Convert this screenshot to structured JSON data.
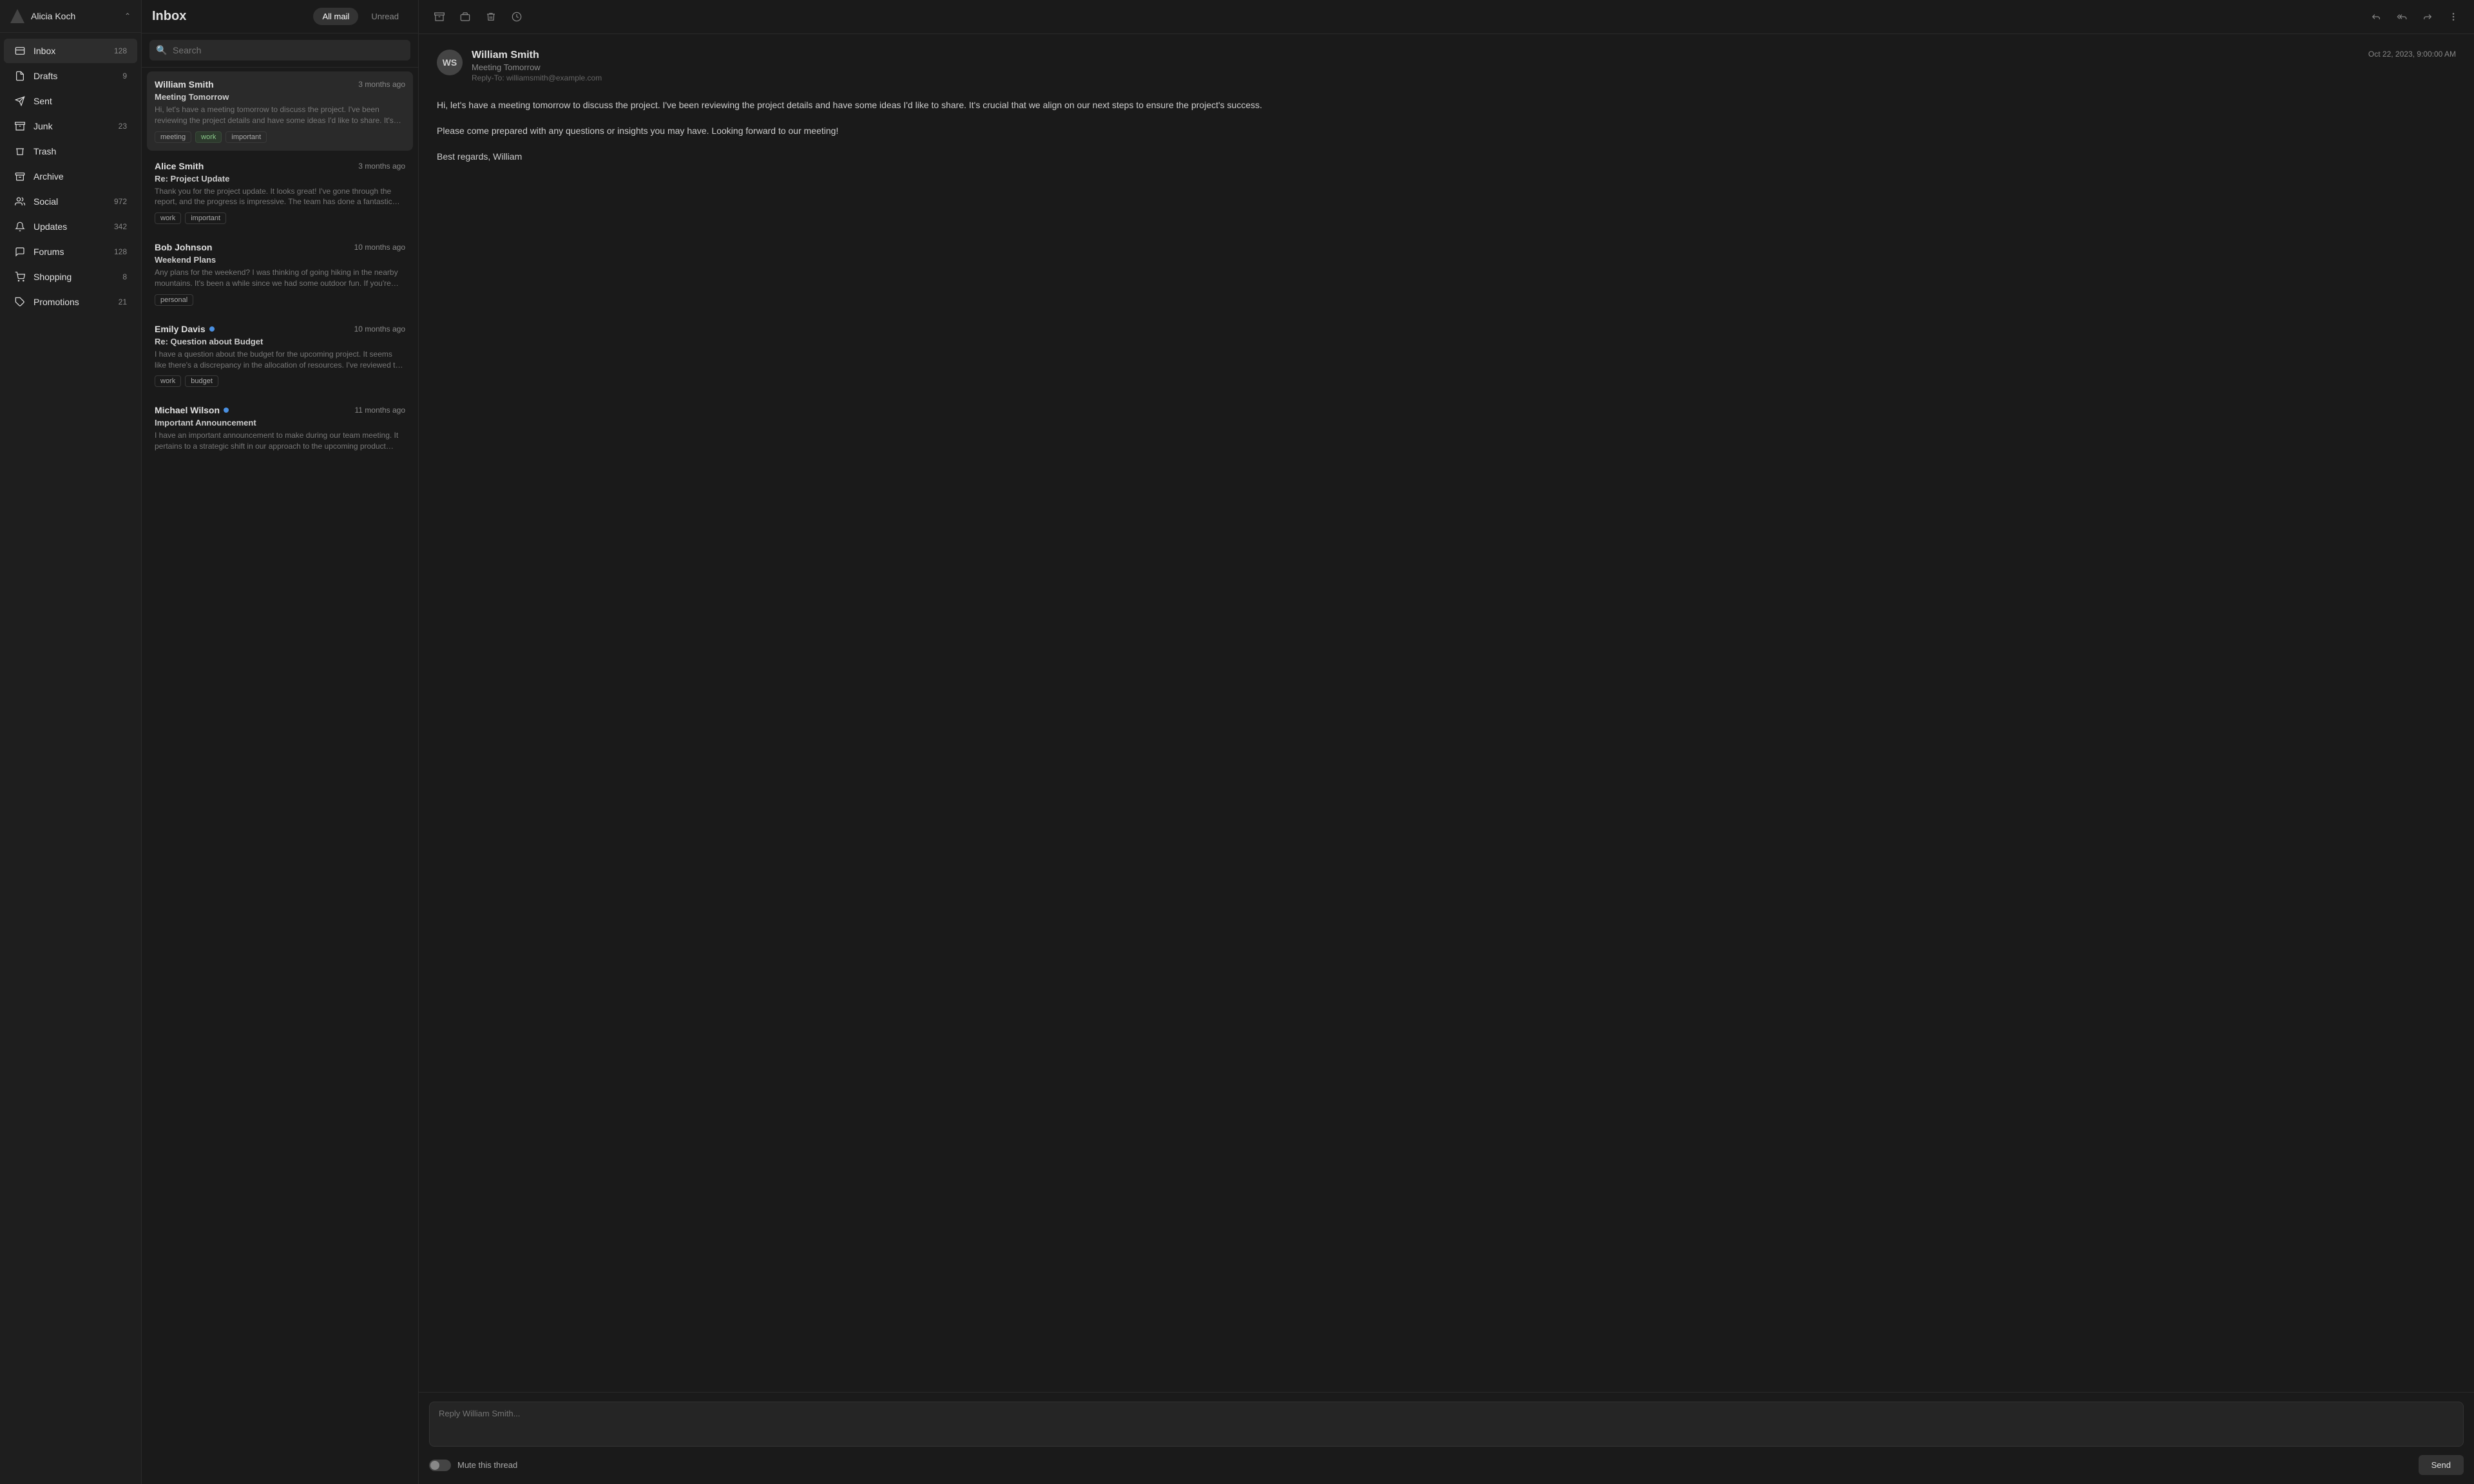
{
  "account": {
    "name": "Alicia Koch",
    "chevron": "⌃"
  },
  "sidebar": {
    "items": [
      {
        "id": "inbox",
        "label": "Inbox",
        "count": "128",
        "icon": "inbox",
        "active": true
      },
      {
        "id": "drafts",
        "label": "Drafts",
        "count": "9",
        "icon": "file"
      },
      {
        "id": "sent",
        "label": "Sent",
        "count": "",
        "icon": "send"
      },
      {
        "id": "junk",
        "label": "Junk",
        "count": "23",
        "icon": "archive"
      },
      {
        "id": "trash",
        "label": "Trash",
        "count": "",
        "icon": "trash"
      },
      {
        "id": "archive",
        "label": "Archive",
        "count": "",
        "icon": "archive2"
      },
      {
        "id": "social",
        "label": "Social",
        "count": "972",
        "icon": "users"
      },
      {
        "id": "updates",
        "label": "Updates",
        "count": "342",
        "icon": "bell"
      },
      {
        "id": "forums",
        "label": "Forums",
        "count": "128",
        "icon": "message"
      },
      {
        "id": "shopping",
        "label": "Shopping",
        "count": "8",
        "icon": "shopping"
      },
      {
        "id": "promotions",
        "label": "Promotions",
        "count": "21",
        "icon": "tag"
      }
    ]
  },
  "header": {
    "title": "Inbox",
    "filter_all": "All mail",
    "filter_unread": "Unread"
  },
  "search": {
    "placeholder": "Search"
  },
  "emails": [
    {
      "id": "1",
      "sender": "William Smith",
      "subject": "Meeting Tomorrow",
      "preview": "Hi, let's have a meeting tomorrow to discuss the project. I've been reviewing the project details and have some ideas I'd like to share. It's crucial that we align on our...",
      "time": "3 months ago",
      "tags": [
        "meeting",
        "work",
        "important"
      ],
      "unread": false,
      "selected": true,
      "highlighted_tags": [
        "work"
      ]
    },
    {
      "id": "2",
      "sender": "Alice Smith",
      "subject": "Re: Project Update",
      "preview": "Thank you for the project update. It looks great! I've gone through the report, and the progress is impressive. The team has done a fantastic job, and I appreciate the hard...",
      "time": "3 months ago",
      "tags": [
        "work",
        "important"
      ],
      "unread": false,
      "selected": false,
      "highlighted_tags": []
    },
    {
      "id": "3",
      "sender": "Bob Johnson",
      "subject": "Weekend Plans",
      "preview": "Any plans for the weekend? I was thinking of going hiking in the nearby mountains. It's been a while since we had some outdoor fun. If you're interested, let me know,...",
      "time": "10 months ago",
      "tags": [
        "personal"
      ],
      "unread": false,
      "selected": false,
      "highlighted_tags": []
    },
    {
      "id": "4",
      "sender": "Emily Davis",
      "subject": "Re: Question about Budget",
      "preview": "I have a question about the budget for the upcoming project. It seems like there's a discrepancy in the allocation of resources. I've reviewed the budget report and...",
      "time": "10 months ago",
      "tags": [
        "work",
        "budget"
      ],
      "unread": true,
      "selected": false,
      "highlighted_tags": []
    },
    {
      "id": "5",
      "sender": "Michael Wilson",
      "subject": "Important Announcement",
      "preview": "I have an important announcement to make during our team meeting. It pertains to a strategic shift in our approach to the upcoming product launch. We've received...",
      "time": "11 months ago",
      "tags": [],
      "unread": true,
      "selected": false,
      "highlighted_tags": []
    }
  ],
  "detail": {
    "sender": "William Smith",
    "sender_initials": "WS",
    "subject": "Meeting Tomorrow",
    "reply_to": "Reply-To: williamsmith@example.com",
    "date": "Oct 22, 2023, 9:00:00 AM",
    "body": [
      "Hi, let's have a meeting tomorrow to discuss the project. I've been reviewing the project details and have some ideas I'd like to share. It's crucial that we align on our next steps to ensure the project's success.",
      "Please come prepared with any questions or insights you may have. Looking forward to our meeting!",
      "Best regards, William"
    ],
    "reply_placeholder": "Reply William Smith...",
    "mute_label": "Mute this thread",
    "send_label": "Send"
  },
  "toolbar": {
    "archive_label": "Archive",
    "move_junk_label": "Move to junk",
    "delete_label": "Delete",
    "snooze_label": "Snooze",
    "reply_label": "Reply",
    "reply_all_label": "Reply all",
    "forward_label": "Forward",
    "more_label": "More"
  }
}
